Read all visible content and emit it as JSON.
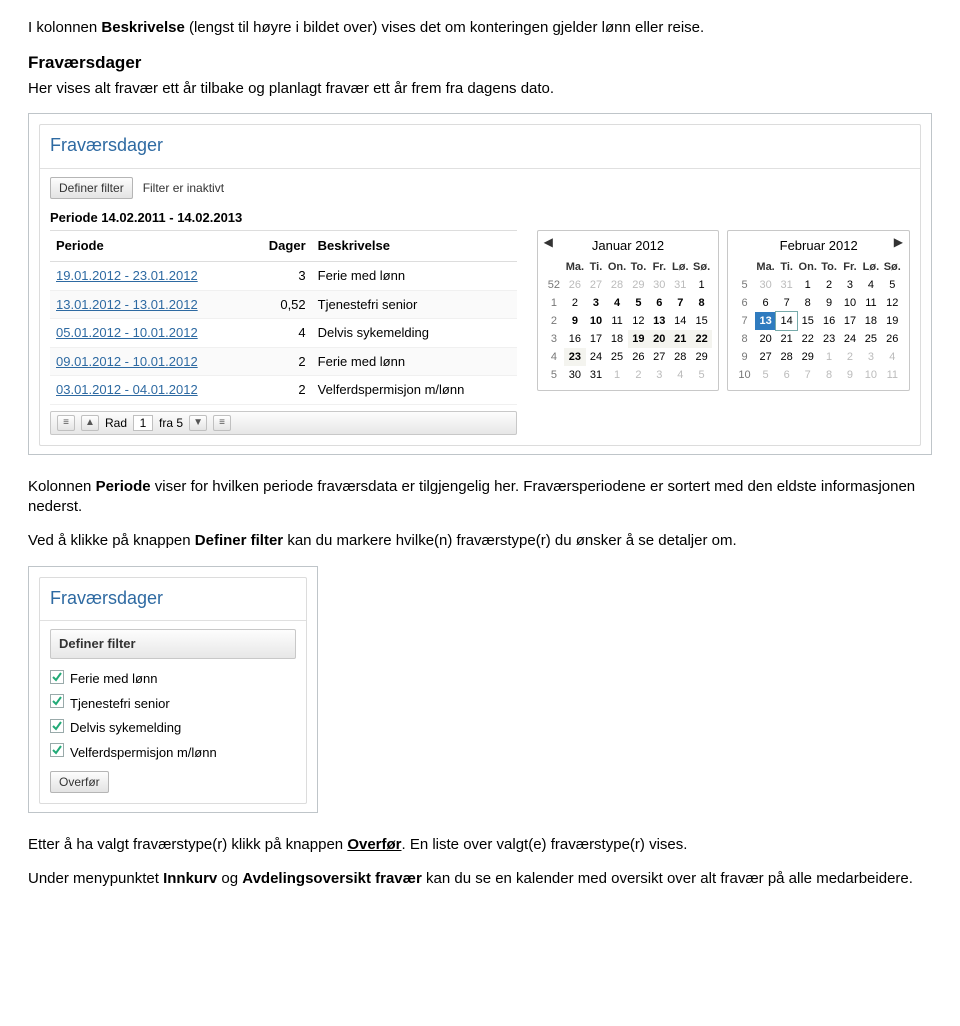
{
  "para1_a": "I kolonnen ",
  "para1_bold": "Beskrivelse",
  "para1_b": " (lengst til høyre i bildet over) vises det om konteringen gjelder lønn eller reise.",
  "heading1": "Fraværsdager",
  "para2": "Her vises alt fravær ett år tilbake og planlagt fravær ett år frem fra dagens dato.",
  "fig1": {
    "title": "Fraværsdager",
    "filter_btn": "Definer filter",
    "filter_status": "Filter er inaktivt",
    "period_line": "Periode 14.02.2011 - 14.02.2013",
    "cols": {
      "period": "Periode",
      "days": "Dager",
      "desc": "Beskrivelse"
    },
    "rows": [
      {
        "period": "19.01.2012 - 23.01.2012",
        "days": "3",
        "desc": "Ferie med lønn"
      },
      {
        "period": "13.01.2012 - 13.01.2012",
        "days": "0,52",
        "desc": "Tjenestefri senior"
      },
      {
        "period": "05.01.2012 - 10.01.2012",
        "days": "4",
        "desc": "Delvis sykemelding"
      },
      {
        "period": "09.01.2012 - 10.01.2012",
        "days": "2",
        "desc": "Ferie med lønn"
      },
      {
        "period": "03.01.2012 - 04.01.2012",
        "days": "2",
        "desc": "Velferdspermisjon m/lønn"
      }
    ],
    "pager": {
      "rad": "Rad",
      "val": "1",
      "of": "fra 5"
    },
    "cal1": {
      "title": "Januar 2012",
      "head": [
        "",
        "Ma.",
        "Ti.",
        "On.",
        "To.",
        "Fr.",
        "Lø.",
        "Sø."
      ],
      "rows": [
        [
          "52",
          "26",
          "27",
          "28",
          "29",
          "30",
          "31",
          "1"
        ],
        [
          "1",
          "2",
          "3",
          "4",
          "5",
          "6",
          "7",
          "8"
        ],
        [
          "2",
          "9",
          "10",
          "11",
          "12",
          "13",
          "14",
          "15"
        ],
        [
          "3",
          "16",
          "17",
          "18",
          "19",
          "20",
          "21",
          "22"
        ],
        [
          "4",
          "23",
          "24",
          "25",
          "26",
          "27",
          "28",
          "29"
        ],
        [
          "5",
          "30",
          "31",
          "1",
          "2",
          "3",
          "4",
          "5"
        ]
      ]
    },
    "cal2": {
      "title": "Februar 2012",
      "head": [
        "",
        "Ma.",
        "Ti.",
        "On.",
        "To.",
        "Fr.",
        "Lø.",
        "Sø."
      ],
      "rows": [
        [
          "5",
          "30",
          "31",
          "1",
          "2",
          "3",
          "4",
          "5"
        ],
        [
          "6",
          "6",
          "7",
          "8",
          "9",
          "10",
          "11",
          "12"
        ],
        [
          "7",
          "13",
          "14",
          "15",
          "16",
          "17",
          "18",
          "19"
        ],
        [
          "8",
          "20",
          "21",
          "22",
          "23",
          "24",
          "25",
          "26"
        ],
        [
          "9",
          "27",
          "28",
          "29",
          "1",
          "2",
          "3",
          "4"
        ],
        [
          "10",
          "5",
          "6",
          "7",
          "8",
          "9",
          "10",
          "11"
        ]
      ]
    }
  },
  "para3_a": "Kolonnen ",
  "para3_bold": "Periode",
  "para3_b": " viser for hvilken periode fraværsdata er tilgjengelig her. Fraværsperiodene er sortert med den eldste informasjonen nederst.",
  "para4_a": "Ved å klikke på knappen ",
  "para4_bold": "Definer filter",
  "para4_b": " kan du markere hvilke(n) fraværstype(r) du ønsker å se detaljer om.",
  "fig2": {
    "title": "Fraværsdager",
    "filter_head": "Definer filter",
    "items": [
      "Ferie med lønn",
      "Tjenestefri senior",
      "Delvis sykemelding",
      "Velferdspermisjon m/lønn"
    ],
    "overfor": "Overfør"
  },
  "para5_a": "Etter å ha valgt fraværstype(r) klikk på knappen ",
  "para5_u": "Overfør",
  "para5_b": ". En liste over valgt(e) fraværstype(r) vises.",
  "para6_a": "Under menypunktet ",
  "para6_b1": "Innkurv",
  "para6_mid": " og ",
  "para6_b2": "Avdelingsoversikt fravær",
  "para6_c": " kan du se en kalender med oversikt over alt fravær på alle medarbeidere."
}
